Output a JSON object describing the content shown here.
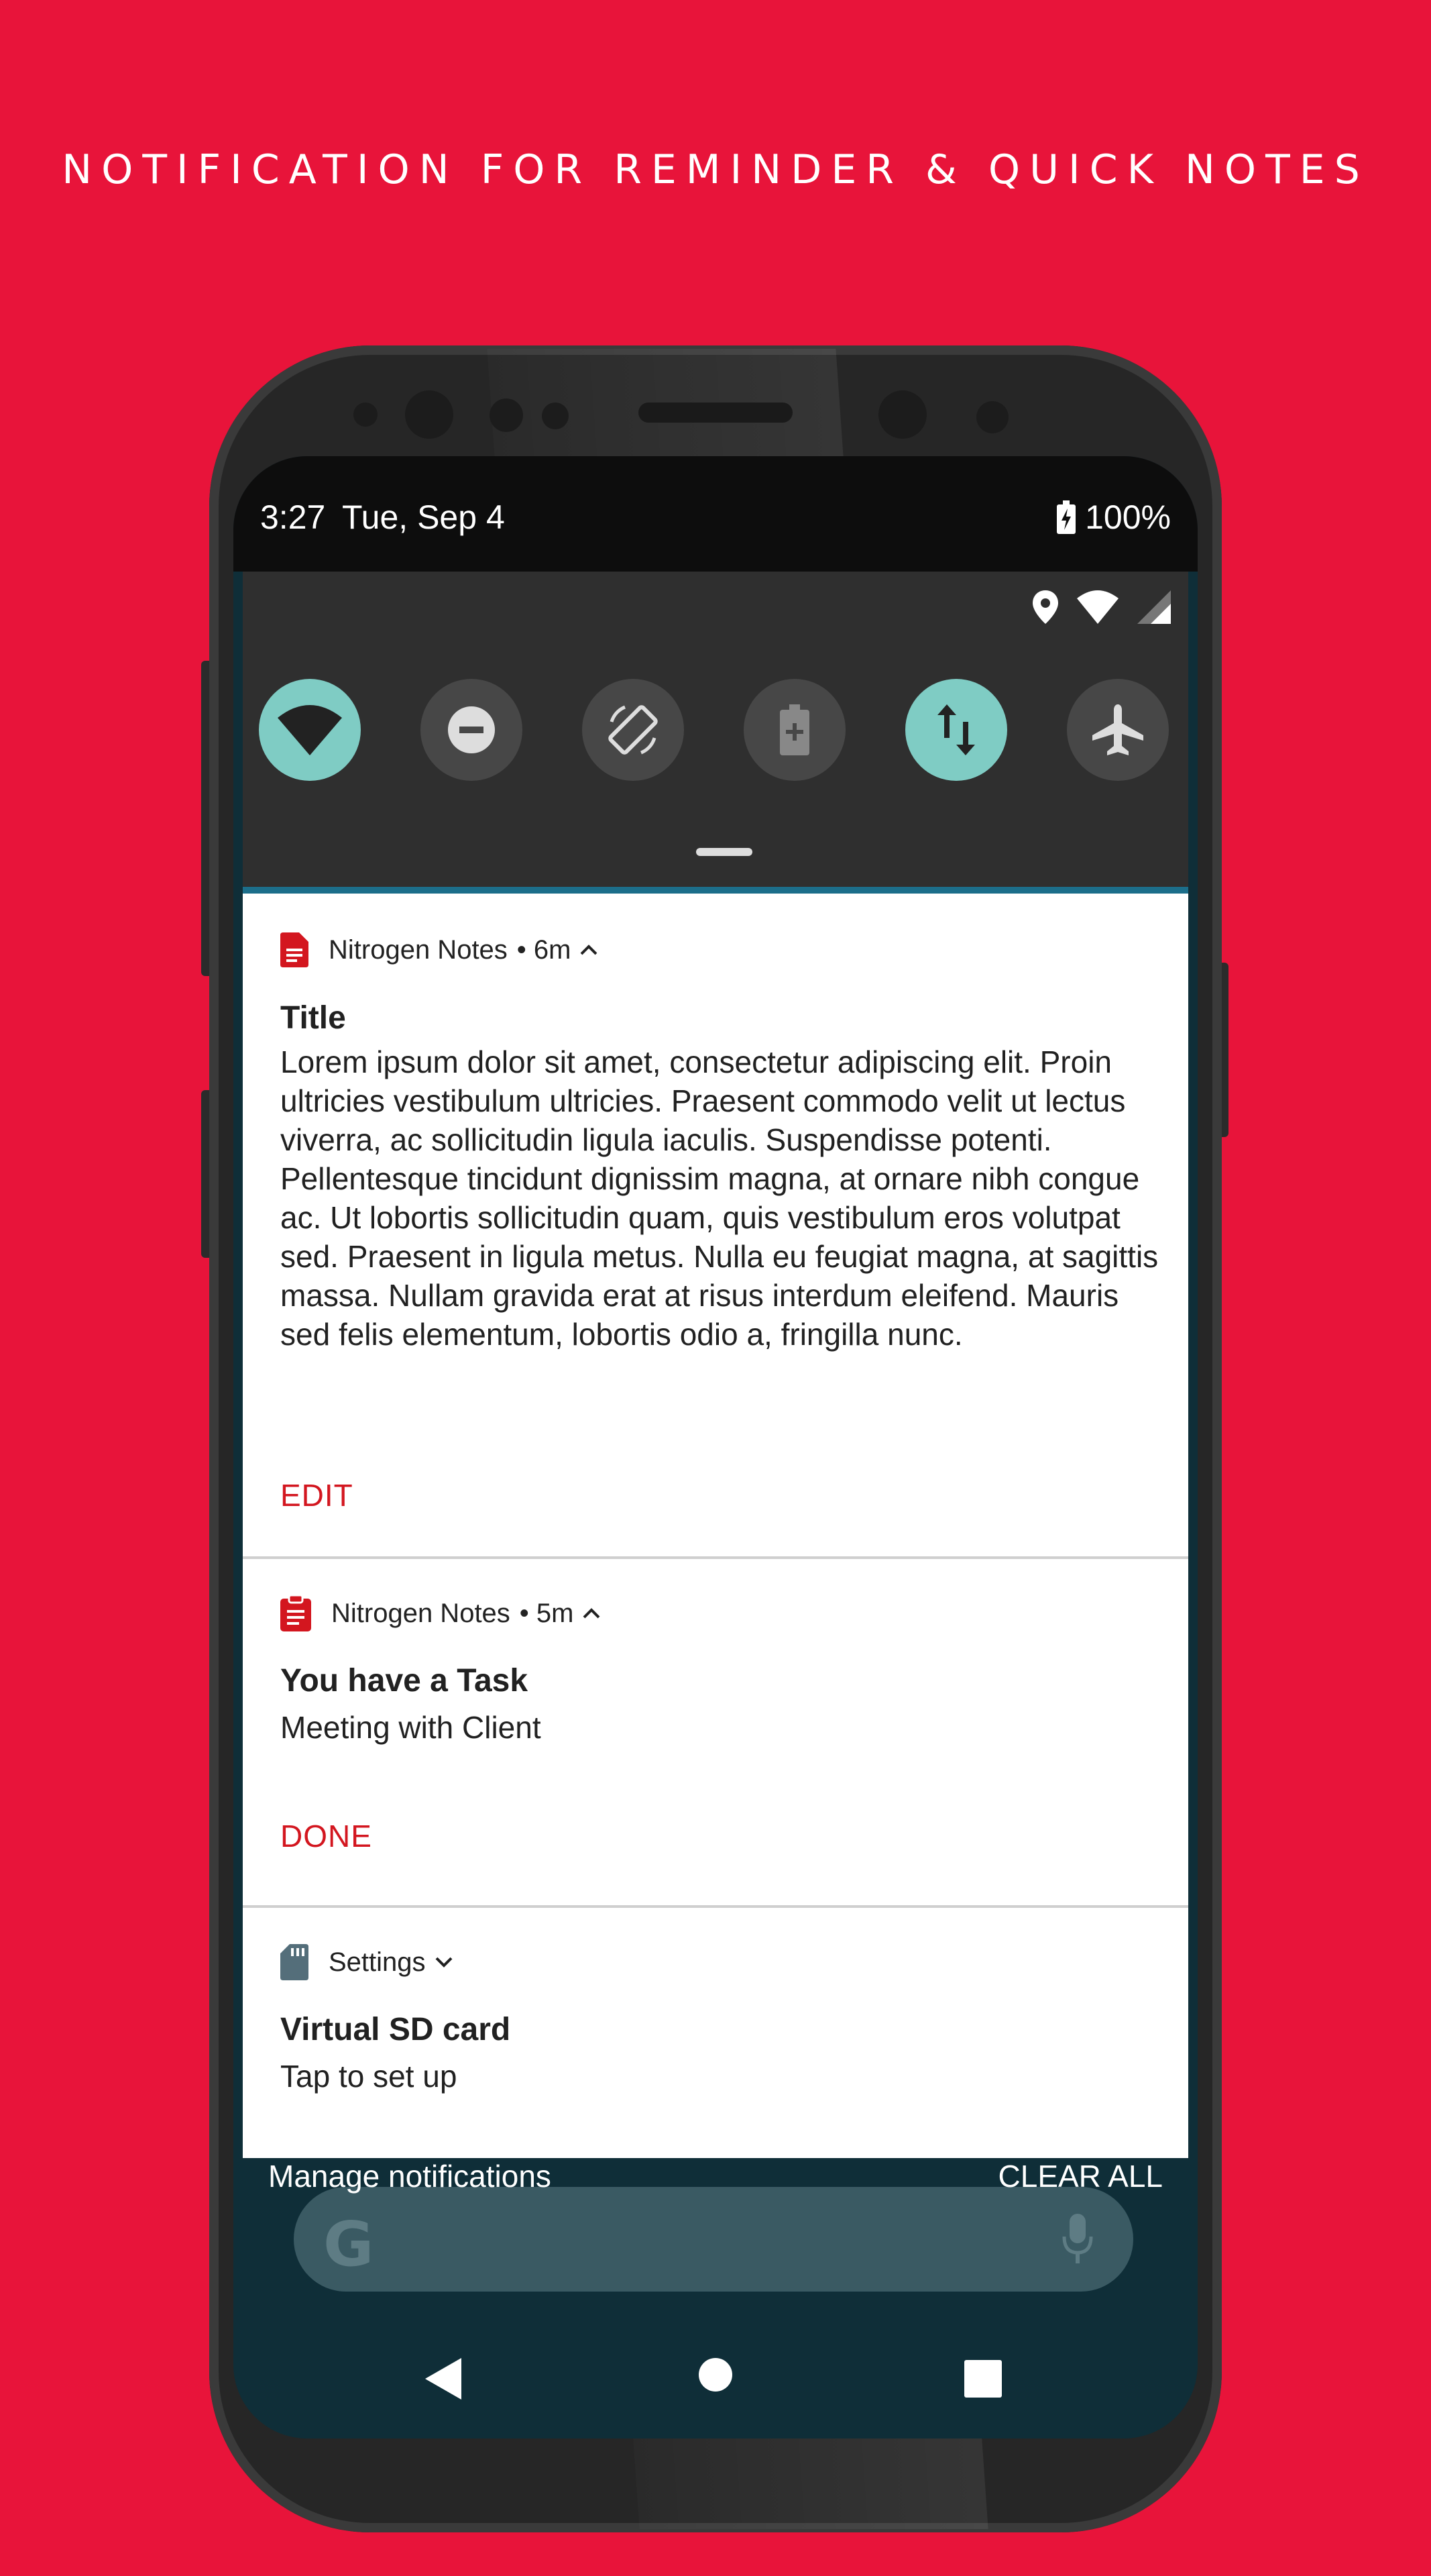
{
  "headline": "NOTIFICATION FOR REMINDER & QUICK NOTES",
  "status_bar": {
    "time": "3:27",
    "date": "Tue, Sep 4",
    "battery": "100%"
  },
  "quick_settings": {
    "tiles": [
      {
        "name": "wifi",
        "icon": "wifi-icon",
        "active": true
      },
      {
        "name": "do-not-disturb",
        "icon": "minus-circle-icon",
        "active": false
      },
      {
        "name": "auto-rotate",
        "icon": "rotate-icon",
        "active": false
      },
      {
        "name": "battery-saver",
        "icon": "battery-plus-icon",
        "active": false
      },
      {
        "name": "mobile-data",
        "icon": "updown-arrows-icon",
        "active": true
      },
      {
        "name": "airplane-mode",
        "icon": "airplane-icon",
        "active": false
      }
    ]
  },
  "notifications": [
    {
      "app": "Nitrogen Notes",
      "time": "• 6m",
      "title": "Title",
      "body": "Lorem ipsum dolor sit amet, consectetur adipiscing elit. Proin ultricies vestibulum ultricies. Praesent commodo velit ut lectus viverra, ac sollicitudin ligula iaculis. Suspendisse potenti. Pellentesque tincidunt dignissim magna, at ornare nibh congue ac. Ut lobortis sollicitudin quam, quis vestibulum eros volutpat sed. Praesent in ligula metus. Nulla eu feugiat magna, at sagittis massa. Nullam gravida erat at risus interdum eleifend. Mauris sed felis elementum, lobortis odio a, fringilla nunc.",
      "action": "EDIT"
    },
    {
      "app": "Nitrogen Notes",
      "time": "• 5m",
      "title": "You have a Task",
      "body": "Meeting with Client",
      "action": "DONE"
    },
    {
      "app": "Settings",
      "title": "Virtual SD card",
      "body": "Tap to set up"
    }
  ],
  "footer": {
    "manage": "Manage notifications",
    "clear_all": "CLEAR ALL"
  },
  "search": {
    "logo_letter": "G"
  },
  "colors": {
    "background": "#e8143a",
    "accent": "#d3161f",
    "tile_active": "#7fccc4"
  }
}
